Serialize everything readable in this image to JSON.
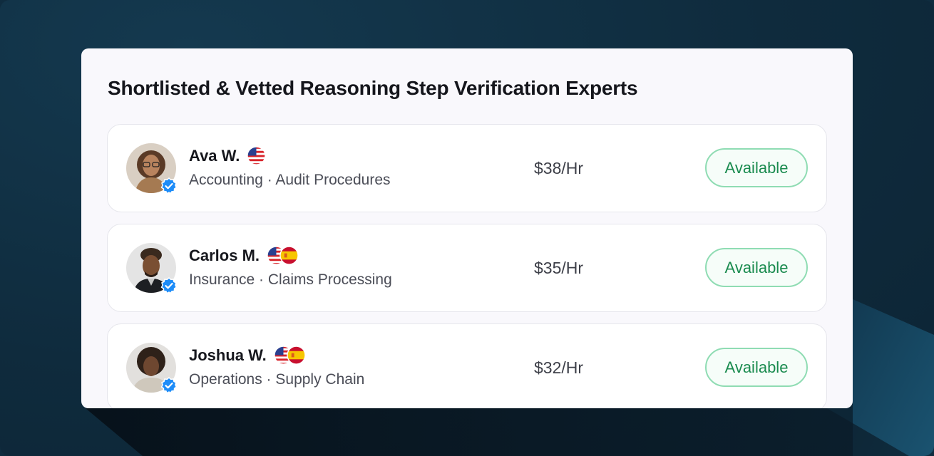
{
  "panel": {
    "title": "Shortlisted & Vetted Reasoning Step Verification Experts"
  },
  "experts": [
    {
      "name": "Ava W.",
      "flags": [
        "us-flag-icon"
      ],
      "skills": "Accounting · Audit Procedures",
      "rate": "$38/Hr",
      "status": "Available"
    },
    {
      "name": "Carlos M.",
      "flags": [
        "us-flag-icon",
        "spain-flag-icon"
      ],
      "skills": "Insurance · Claims Processing",
      "rate": "$35/Hr",
      "status": "Available"
    },
    {
      "name": "Joshua W.",
      "flags": [
        "us-flag-icon",
        "spain-flag-icon"
      ],
      "skills": "Operations · Supply Chain",
      "rate": "$32/Hr",
      "status": "Available"
    }
  ],
  "colors": {
    "background": "#0f2c3f",
    "card": "#f9f8fc",
    "status_text": "#1a8b4f",
    "status_border": "#8fdcb3",
    "verified_badge": "#1d8cf8"
  }
}
